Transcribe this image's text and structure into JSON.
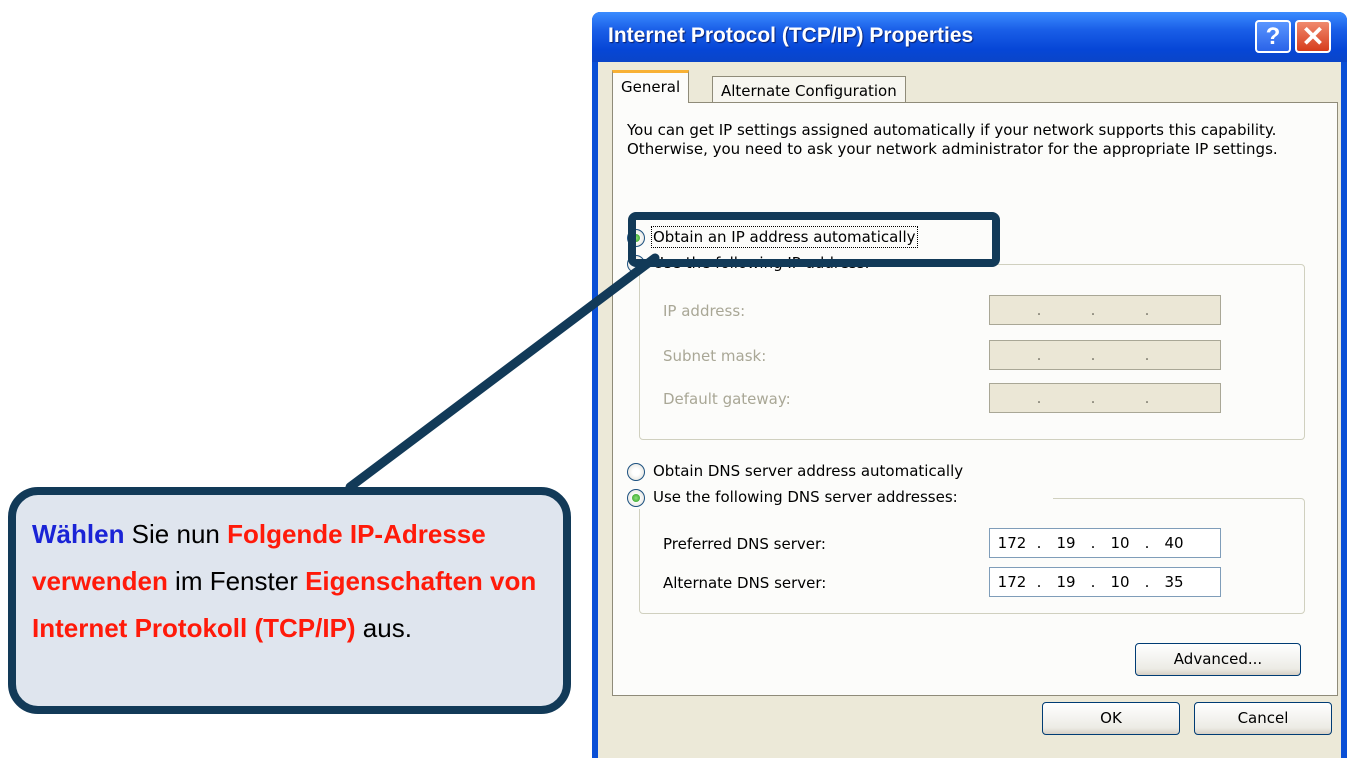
{
  "dialog": {
    "title": "Internet Protocol (TCP/IP) Properties",
    "help_label": "?",
    "close_label": "✕",
    "tabs": [
      {
        "label": "General",
        "active": true
      },
      {
        "label": "Alternate Configuration",
        "active": false
      }
    ],
    "intro_text": "You can get IP settings assigned automatically if your network supports this capability. Otherwise, you need to ask your network administrator for the appropriate IP settings.",
    "ip_mode": {
      "obtain_auto": {
        "label": "Obtain an IP address automatically",
        "checked": true
      },
      "use_following": {
        "label": "Use the following IP address:",
        "checked": false
      }
    },
    "ip_fields": [
      {
        "label": "IP address:",
        "octets": [
          "",
          "",
          "",
          ""
        ]
      },
      {
        "label": "Subnet mask:",
        "octets": [
          "",
          "",
          "",
          ""
        ]
      },
      {
        "label": "Default gateway:",
        "octets": [
          "",
          "",
          "",
          ""
        ]
      }
    ],
    "dns_mode": {
      "obtain_auto": {
        "label": "Obtain DNS server address automatically",
        "checked": false
      },
      "use_following": {
        "label": "Use the following DNS server addresses:",
        "checked": true
      }
    },
    "dns_fields": [
      {
        "label": "Preferred DNS server:",
        "octets": [
          "172",
          "19",
          "10",
          "40"
        ]
      },
      {
        "label": "Alternate DNS server:",
        "octets": [
          "172",
          "19",
          "10",
          "35"
        ]
      }
    ],
    "advanced_label": "Advanced...",
    "ok_label": "OK",
    "cancel_label": "Cancel"
  },
  "callout": {
    "segments": [
      {
        "text": "Wählen",
        "style": "blue"
      },
      {
        "text": " Sie nun ",
        "style": "plain"
      },
      {
        "text": "Folgende IP-Adresse verwenden",
        "style": "red"
      },
      {
        "text": " im Fenster ",
        "style": "plain"
      },
      {
        "text": "Eigenschaften von Internet Protokoll (TCP/IP)",
        "style": "red"
      },
      {
        "text": " aus.",
        "style": "plain"
      }
    ]
  },
  "colors": {
    "callout_border": "#123a58",
    "callout_fill": "#dfe5ee",
    "highlight_blue": "#1a23d6",
    "highlight_red": "#ff1a0a",
    "titlebar": "#0a4fd6"
  }
}
